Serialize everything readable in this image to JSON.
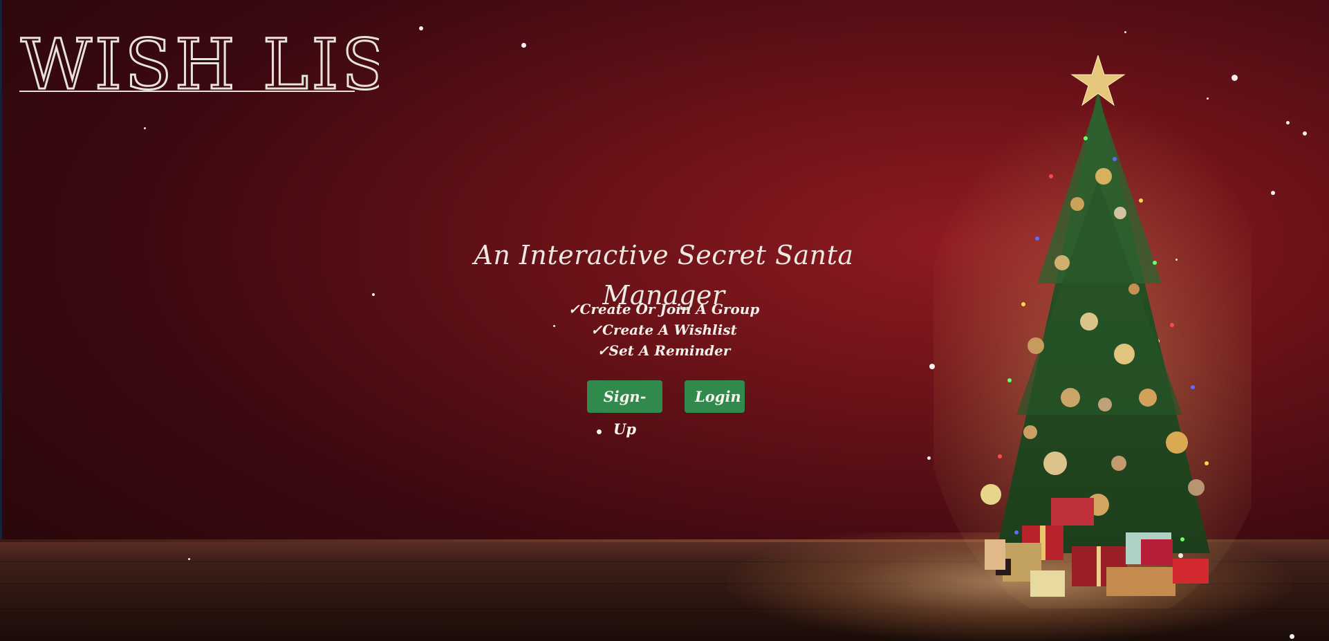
{
  "logo": {
    "text": "WISH LIST"
  },
  "hero": {
    "tagline": "An Interactive Secret Santa Manager",
    "features": [
      "✓Create Or Join A Group",
      "✓Create A Wishlist",
      "✓Set A Reminder"
    ]
  },
  "actions": {
    "signup_label": "Sign-Up",
    "login_label": "Login"
  },
  "colors": {
    "background": "#6a1218",
    "button": "#2f8a4c",
    "text": "#ece8e2"
  }
}
